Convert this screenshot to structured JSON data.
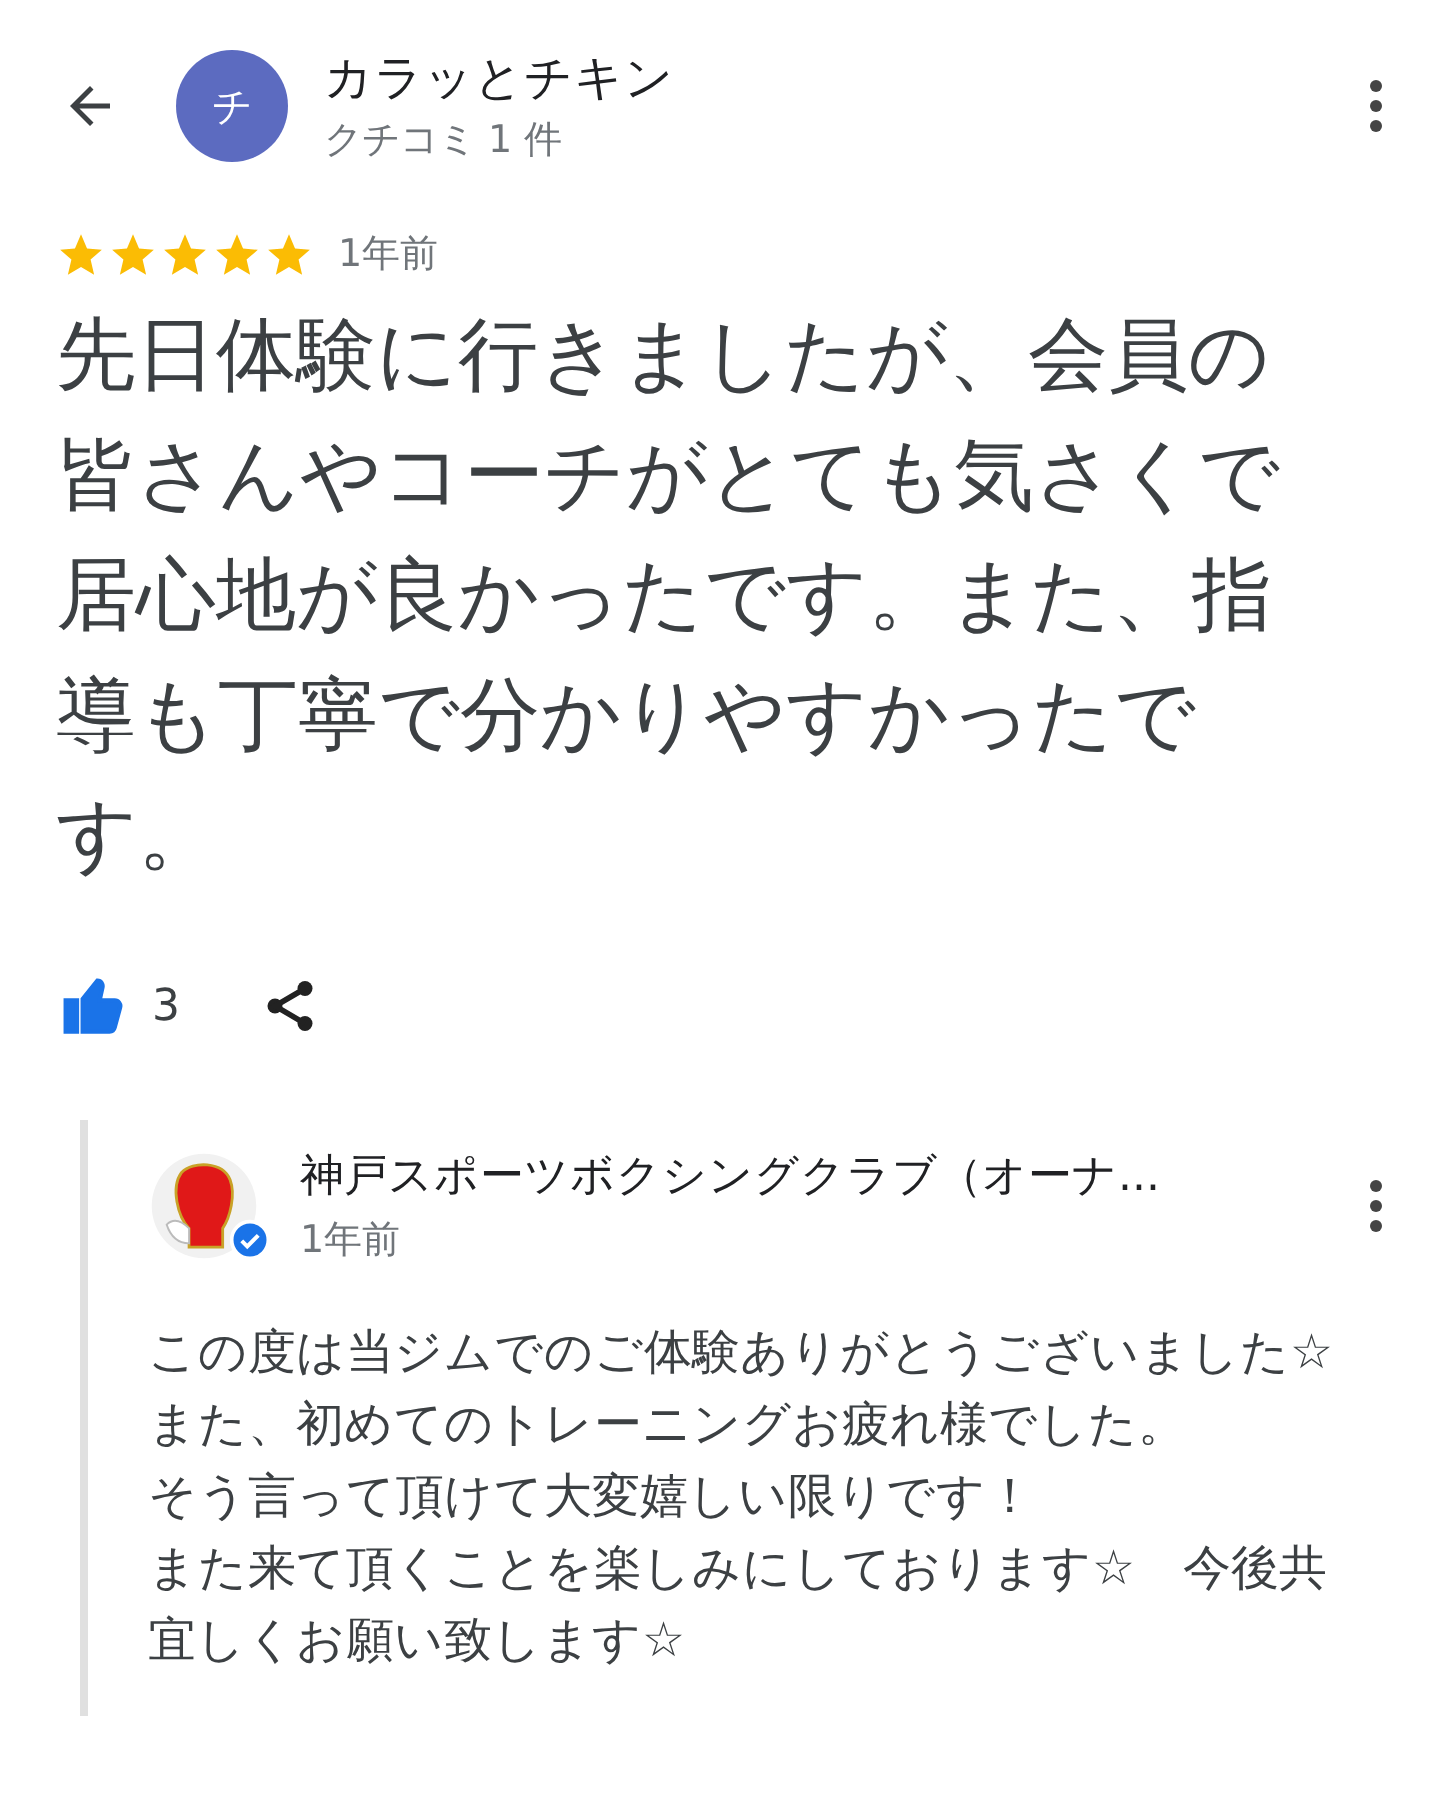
{
  "reviewer": {
    "avatar_letter": "チ",
    "name": "カラッとチキン",
    "review_count": "クチコミ 1 件"
  },
  "review": {
    "stars": 5,
    "time": "1年前",
    "text": "先日体験に行きましたが、会員の皆さんやコーチがとても気さくで居心地が良かったです。また、指導も丁寧で分かりやすかったです。",
    "likes": "3",
    "liked": true
  },
  "owner_reply": {
    "name": "神戸スポーツボクシングクラブ（オーナ...",
    "verified": true,
    "time": "1年前",
    "lines": [
      "この度は当ジムでのご体験ありがとうございました☆",
      "また、初めてのトレーニングお疲れ様でした。",
      "そう言って頂けて大変嬉しい限りです！",
      "また来て頂くことを楽しみにしております☆　今後共宜しくお願い致します☆"
    ]
  }
}
